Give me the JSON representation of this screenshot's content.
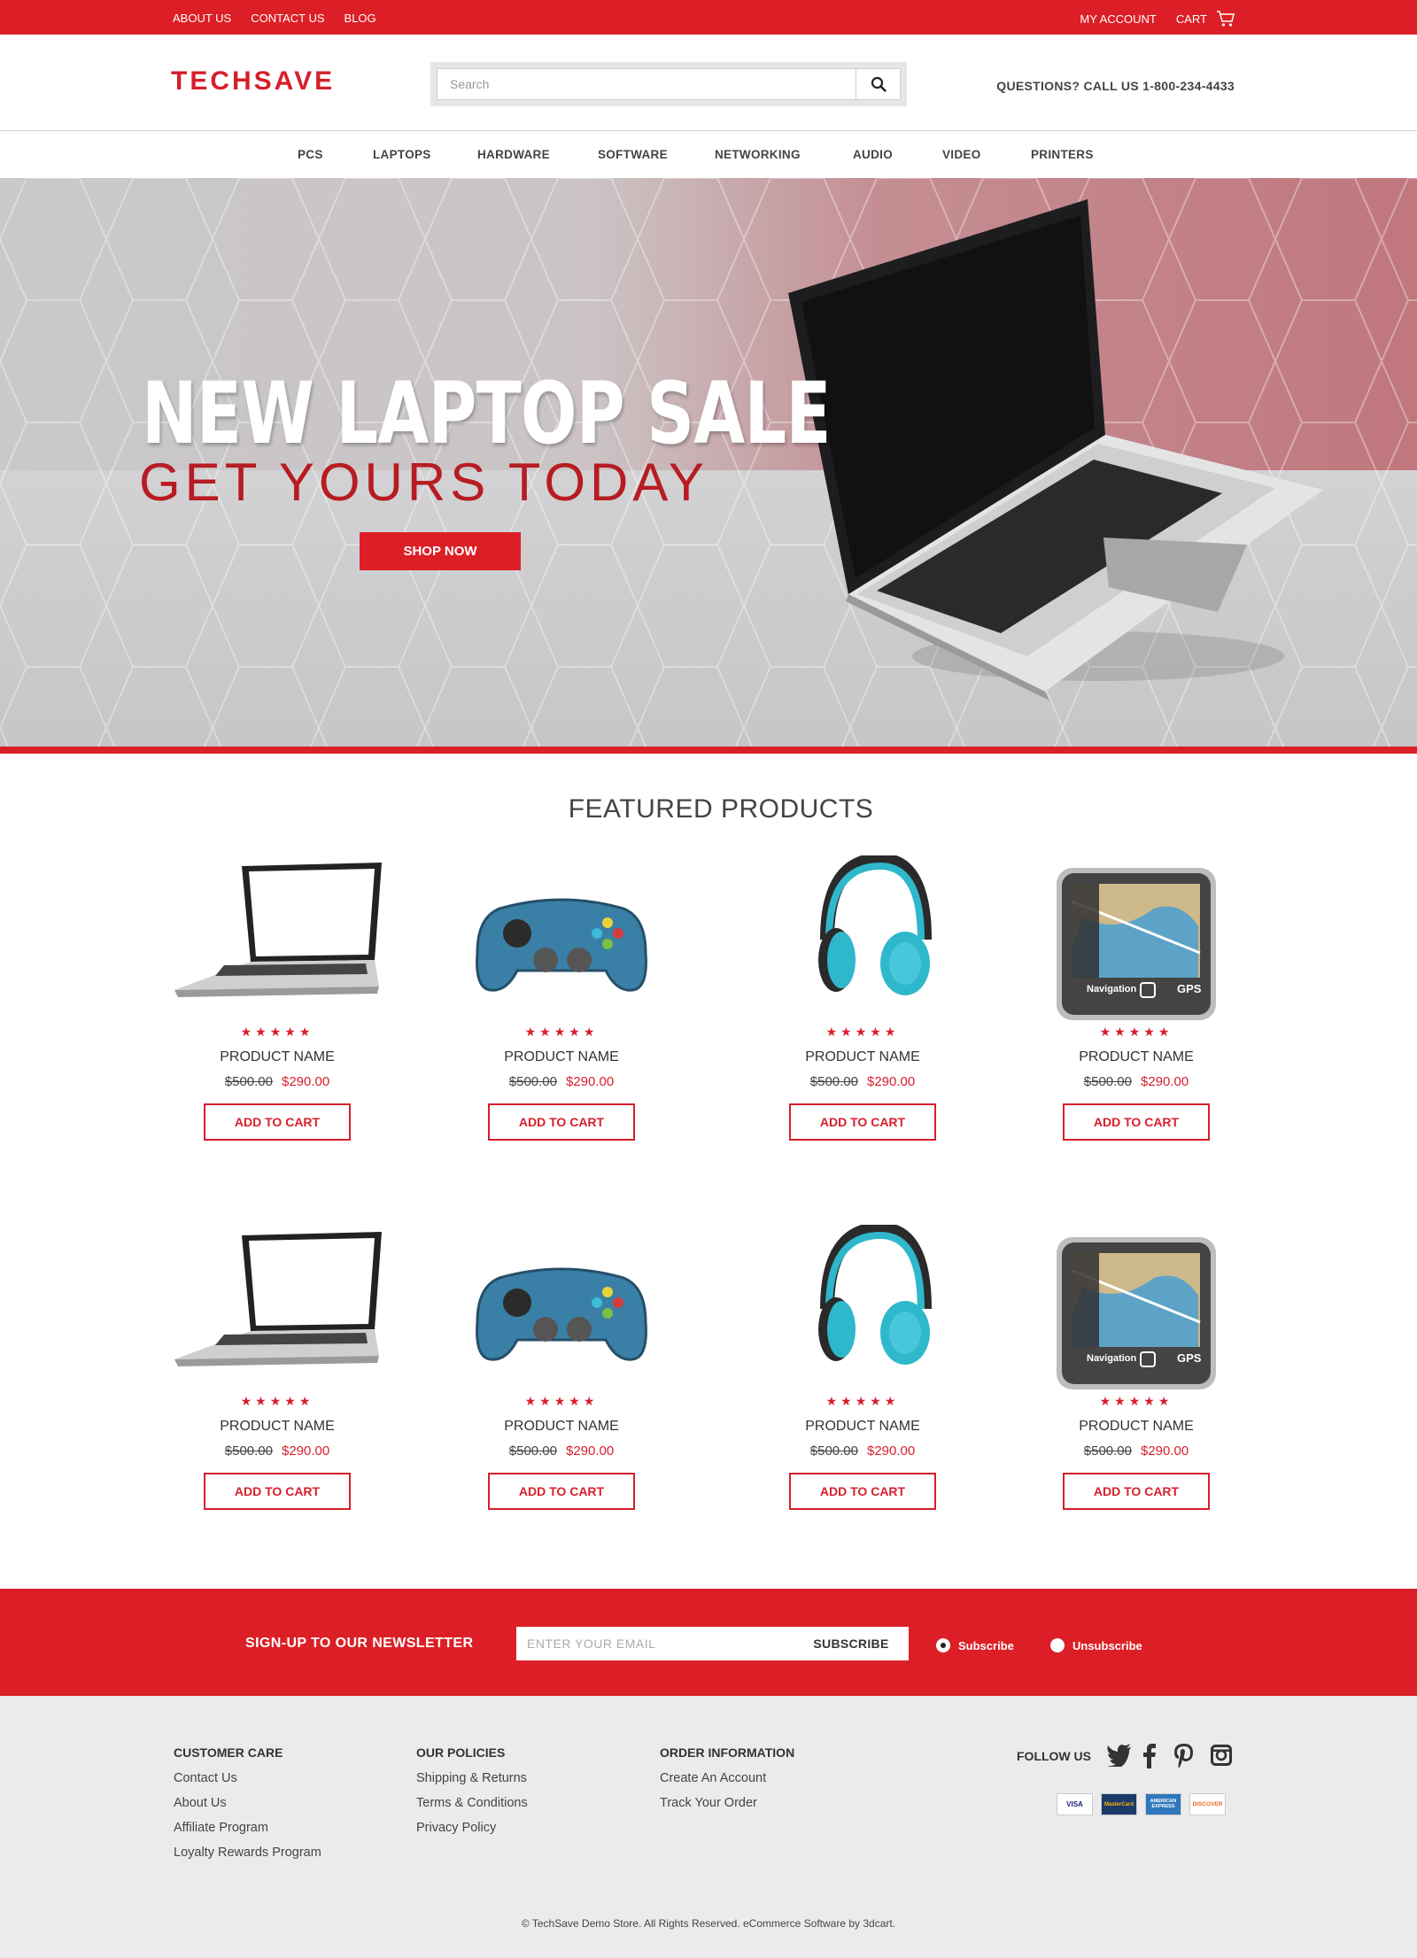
{
  "topbar": {
    "left_links": [
      "ABOUT US",
      "CONTACT US",
      "BLOG"
    ],
    "my_account": "MY ACCOUNT",
    "cart": "CART"
  },
  "header": {
    "logo": "TECHSAVE",
    "search_placeholder": "Search",
    "phone": "QUESTIONS? CALL US 1-800-234-4433"
  },
  "nav": [
    "PCS",
    "LAPTOPS",
    "HARDWARE",
    "SOFTWARE",
    "NETWORKING",
    "AUDIO",
    "VIDEO",
    "PRINTERS"
  ],
  "hero": {
    "title": "NEW LAPTOP SALE",
    "subtitle": "GET YOURS TODAY",
    "button": "SHOP NOW"
  },
  "featured": {
    "title": "FEATURED PRODUCTS",
    "products": [
      {
        "image": "laptop",
        "stars": "★★★★★",
        "name": "PRODUCT NAME",
        "old_price": "$500.00",
        "new_price": "$290.00",
        "button": "ADD TO CART"
      },
      {
        "image": "gamepad",
        "stars": "★★★★★",
        "name": "PRODUCT NAME",
        "old_price": "$500.00",
        "new_price": "$290.00",
        "button": "ADD TO CART"
      },
      {
        "image": "headphones",
        "stars": "★★★★★",
        "name": "PRODUCT NAME",
        "old_price": "$500.00",
        "new_price": "$290.00",
        "button": "ADD TO CART"
      },
      {
        "image": "gps",
        "stars": "★★★★★",
        "name": "PRODUCT NAME",
        "old_price": "$500.00",
        "new_price": "$290.00",
        "button": "ADD TO CART"
      },
      {
        "image": "laptop",
        "stars": "★★★★★",
        "name": "PRODUCT NAME",
        "old_price": "$500.00",
        "new_price": "$290.00",
        "button": "ADD TO CART"
      },
      {
        "image": "gamepad",
        "stars": "★★★★★",
        "name": "PRODUCT NAME",
        "old_price": "$500.00",
        "new_price": "$290.00",
        "button": "ADD TO CART"
      },
      {
        "image": "headphones",
        "stars": "★★★★★",
        "name": "PRODUCT NAME",
        "old_price": "$500.00",
        "new_price": "$290.00",
        "button": "ADD TO CART"
      },
      {
        "image": "gps",
        "stars": "★★★★★",
        "name": "PRODUCT NAME",
        "old_price": "$500.00",
        "new_price": "$290.00",
        "button": "ADD TO CART"
      }
    ],
    "gps_texts": {
      "nav": "Navigation",
      "gps": "GPS"
    }
  },
  "newsletter": {
    "label": "SIGN-UP TO OUR NEWSLETTER",
    "placeholder": "ENTER YOUR EMAIL",
    "button": "SUBSCRIBE",
    "opt_subscribe": "Subscribe",
    "opt_unsubscribe": "Unsubscribe"
  },
  "footer": {
    "customer_care": {
      "title": "CUSTOMER CARE",
      "links": [
        "Contact Us",
        "About Us",
        "Affiliate Program",
        "Loyalty Rewards Program"
      ]
    },
    "our_policies": {
      "title": "OUR POLICIES",
      "links": [
        "Shipping & Returns",
        "Terms & Conditions",
        "Privacy Policy"
      ]
    },
    "order_info": {
      "title": "ORDER INFORMATION",
      "links": [
        "Create An Account",
        "Track Your Order"
      ]
    },
    "follow_us": "FOLLOW US",
    "social_icons": [
      "twitter-icon",
      "facebook-icon",
      "pinterest-icon",
      "instagram-icon"
    ],
    "cards": [
      "VISA",
      "MasterCard",
      "AMERICAN EXPRESS",
      "DISCOVER"
    ],
    "copyright": "© TechSave Demo Store. All Rights Reserved. eCommerce Software by 3dcart."
  },
  "colors": {
    "brand_red": "#dc1f26",
    "footer_bg": "#ebebeb"
  }
}
